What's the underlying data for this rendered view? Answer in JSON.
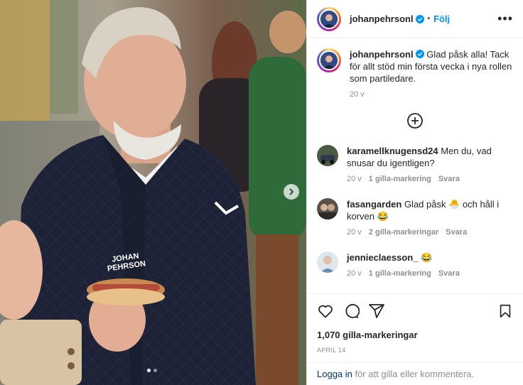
{
  "post": {
    "username": "johanpehrsonl",
    "follow_label": "Följ",
    "separator": "•",
    "more_label": "•••"
  },
  "photo": {
    "vest_text_line1": "JOHAN",
    "vest_text_line2": "PEHRSON",
    "carousel_total": 2,
    "carousel_active": 1
  },
  "caption": {
    "username": "johanpehrsonl",
    "text": "Glad påsk alla! Tack för allt stöd min första vecka i nya rollen som partiledare.",
    "time": "20 v"
  },
  "comments": [
    {
      "username": "karamellknugensd24",
      "text": "Men du, vad snusar du igentligen?",
      "time": "20 v",
      "likes": "1 gilla-markering",
      "reply": "Svara"
    },
    {
      "username": "fasangarden",
      "text": "Glad påsk 🐣 och håll i korven 😂",
      "time": "20 v",
      "likes": "2 gilla-markeringar",
      "reply": "Svara"
    },
    {
      "username": "jennieclaesson_",
      "text": "😂",
      "time": "20 v",
      "likes": "1 gilla-markering",
      "reply": "Svara"
    }
  ],
  "footer": {
    "likes": "1,070 gilla-markeringar",
    "date": "APRIL 14",
    "login_link": "Logga in",
    "login_text": " för att gilla eller kommentera."
  },
  "colors": {
    "link": "#0095f6",
    "verified": "#0095f6",
    "muted": "#8e8e8e"
  }
}
